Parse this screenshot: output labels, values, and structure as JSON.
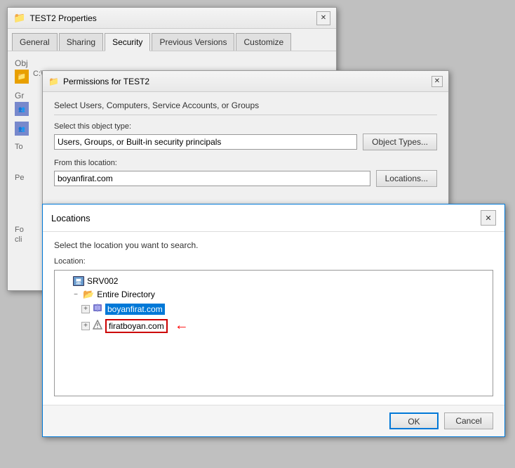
{
  "properties_dialog": {
    "title": "TEST2 Properties",
    "tabs": [
      "General",
      "Sharing",
      "Security",
      "Previous Versions",
      "Customize"
    ],
    "active_tab": "Security",
    "object_name_label": "Obj",
    "group_label": "Gr"
  },
  "permissions_dialog": {
    "title": "Permissions for TEST2",
    "subtitle": "Select Users, Computers, Service Accounts, or Groups",
    "object_type_label": "Select this object type:",
    "object_type_value": "Users, Groups, or Built-in security principals",
    "object_type_button": "Object Types...",
    "location_label": "From this location:",
    "location_value": "boyanfirat.com",
    "location_button": "Locations..."
  },
  "locations_dialog": {
    "title": "Locations",
    "description": "Select the location you want to search.",
    "location_label": "Location:",
    "tree_items": [
      {
        "id": "srv002",
        "indent": 0,
        "label": "SRV002",
        "expand": "",
        "icon_type": "computer"
      },
      {
        "id": "entire_dir",
        "indent": 1,
        "label": "Entire Directory",
        "expand": "−",
        "icon_type": "folder_open"
      },
      {
        "id": "boyanfirat",
        "indent": 2,
        "label": "boyanfirat.com",
        "expand": "+",
        "icon_type": "domain",
        "selected": true
      },
      {
        "id": "firatboyan",
        "indent": 2,
        "label": "firatboyan.com",
        "expand": "+",
        "icon_type": "domain_trust",
        "highlighted": true
      }
    ],
    "ok_label": "OK",
    "cancel_label": "Cancel"
  },
  "icons": {
    "close": "✕",
    "expand_plus": "+",
    "expand_minus": "−",
    "arrow_right": "→",
    "folder": "📁",
    "computer": "🖥",
    "network": "🌐",
    "shield": "🛡"
  }
}
